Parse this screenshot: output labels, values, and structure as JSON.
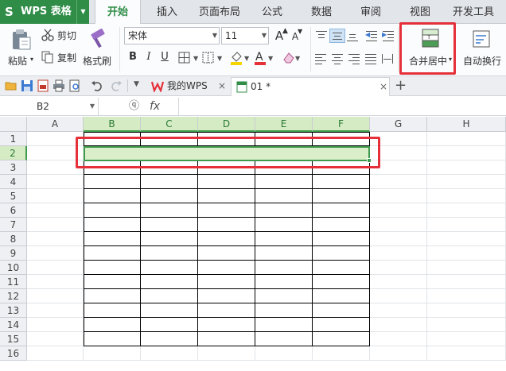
{
  "app": {
    "logo": "S",
    "title": "WPS 表格",
    "dropdown_arrow": "▼"
  },
  "menu": [
    "开始",
    "插入",
    "页面布局",
    "公式",
    "数据",
    "审阅",
    "视图",
    "开发工具"
  ],
  "ribbon": {
    "paste_label": "粘贴",
    "cut_label": "剪切",
    "copy_label": "复制",
    "format_painter_label": "格式刷",
    "font_name": "宋体",
    "font_size": "11",
    "bold": "B",
    "italic": "I",
    "underline": "U",
    "font_grow": "A",
    "font_shrink": "A",
    "merge_center_label": "合并居中",
    "wrap_text_label": "自动换行",
    "font_color": "#e5303a",
    "fill_color": "#f5d400"
  },
  "doc_tabs": [
    {
      "label": "我的WPS",
      "close": "×"
    },
    {
      "label": "01 *",
      "close": "×"
    }
  ],
  "new_tab": "+",
  "formula_bar": {
    "cell_ref": "B2",
    "fx": "fx",
    "zoom_icon": "ⓠ"
  },
  "columns": [
    "A",
    "B",
    "C",
    "D",
    "E",
    "F",
    "G",
    "H"
  ],
  "rows": [
    "1",
    "2",
    "3",
    "4",
    "5",
    "6",
    "7",
    "8",
    "9",
    "10",
    "11",
    "12",
    "13",
    "14",
    "15",
    "16"
  ],
  "selection": {
    "active_cell": "B2",
    "range": "B2:F2"
  },
  "colors": {
    "brand_green": "#2f8d47",
    "highlight_red": "#e5303a",
    "selection_fill": "#d9eec9"
  }
}
